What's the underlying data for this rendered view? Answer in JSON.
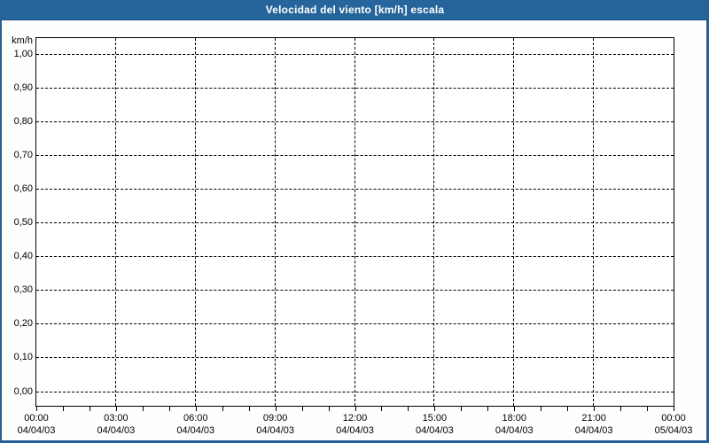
{
  "window": {
    "border_color": "#2b5f97",
    "background": "#fdfffd"
  },
  "title_bar": {
    "label": "Velocidad del viento [km/h] escala",
    "background": "#26659b",
    "text_color": "#ffffff"
  },
  "chart": {
    "unit_label": "km/h",
    "y_axis": {
      "tick_labels": [
        "1,00",
        "0,90",
        "0,80",
        "0,70",
        "0,60",
        "0,50",
        "0,40",
        "0,30",
        "0,20",
        "0,10",
        "0,00"
      ]
    },
    "x_axis": {
      "major_ticks": [
        {
          "time": "00:00",
          "date": "04/04/03"
        },
        {
          "time": "03:00",
          "date": "04/04/03"
        },
        {
          "time": "06:00",
          "date": "04/04/03"
        },
        {
          "time": "09:00",
          "date": "04/04/03"
        },
        {
          "time": "12:00",
          "date": "04/04/03"
        },
        {
          "time": "15:00",
          "date": "04/04/03"
        },
        {
          "time": "18:00",
          "date": "04/04/03"
        },
        {
          "time": "21:00",
          "date": "04/04/03"
        },
        {
          "time": "00:00",
          "date": "05/04/03"
        }
      ],
      "hours_per_major": 3,
      "total_hours": 24
    }
  },
  "chart_data": {
    "type": "line",
    "title": "Velocidad del viento [km/h] escala",
    "xlabel": "",
    "ylabel": "km/h",
    "ylim": [
      -0.05,
      1.05
    ],
    "y_tick_values": [
      0.0,
      0.1,
      0.2,
      0.3,
      0.4,
      0.5,
      0.6,
      0.7,
      0.8,
      0.9,
      1.0
    ],
    "x_tick_labels": [
      "00:00",
      "03:00",
      "06:00",
      "09:00",
      "12:00",
      "15:00",
      "18:00",
      "21:00",
      "00:00"
    ],
    "x_tick_dates": [
      "04/04/03",
      "04/04/03",
      "04/04/03",
      "04/04/03",
      "04/04/03",
      "04/04/03",
      "04/04/03",
      "04/04/03",
      "05/04/03"
    ],
    "grid": true,
    "grid_style": "dashed",
    "legend": "none",
    "series": [],
    "note": "empty scale chart - no data series plotted"
  }
}
